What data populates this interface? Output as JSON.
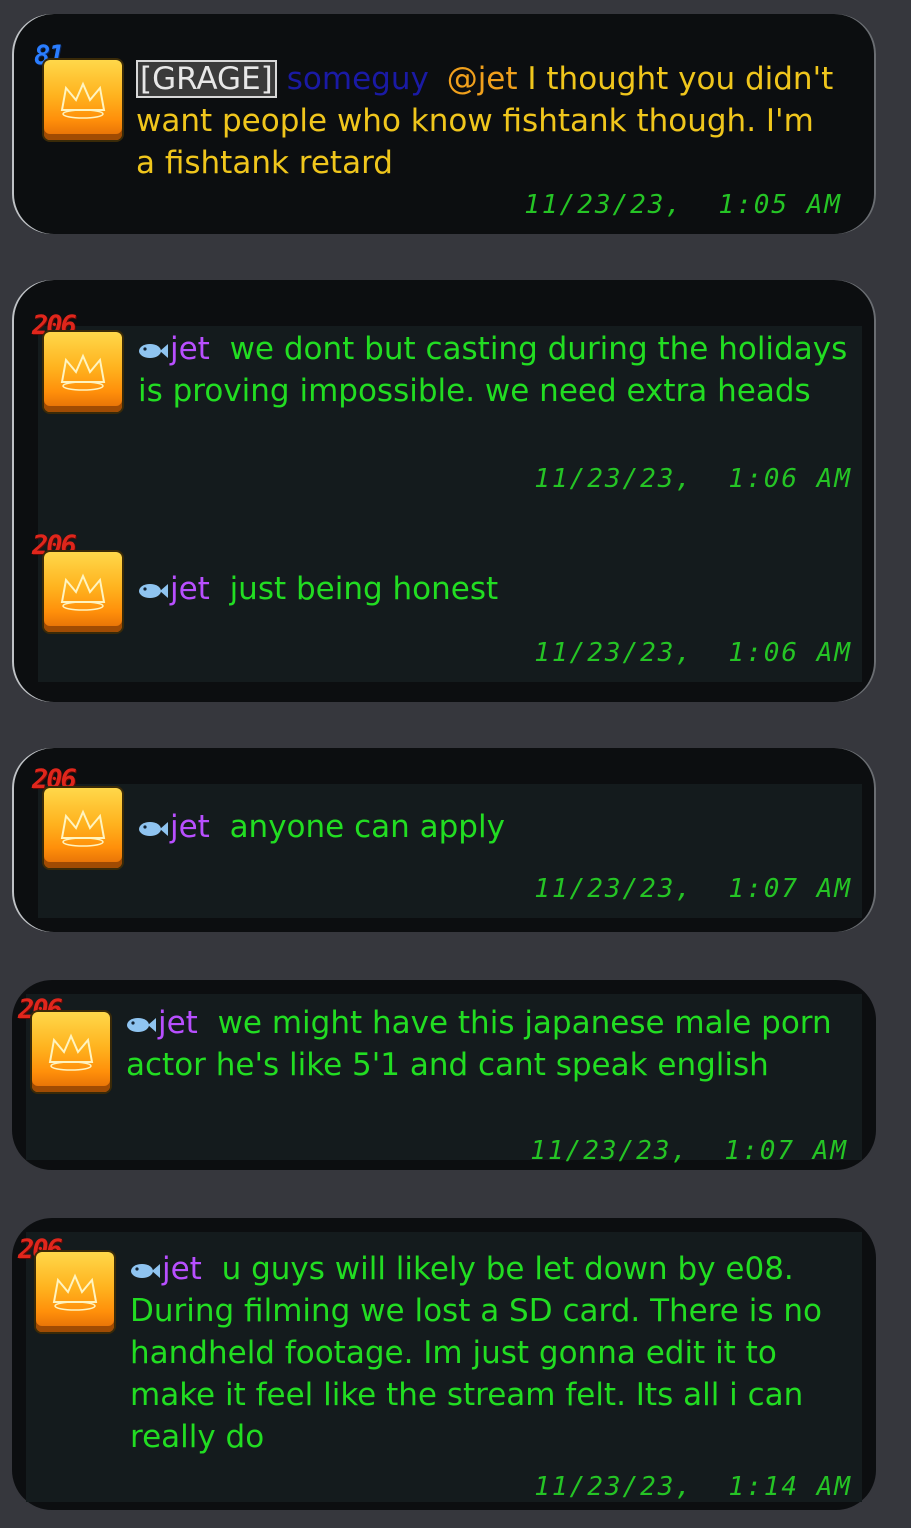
{
  "colors": {
    "background": "#36373d",
    "card": "#0c0e10",
    "message_green": "#22dd22",
    "message_yellow": "#f0c61c",
    "username_purple": "#b84fff",
    "badge_red": "#e0261c",
    "badge_blue": "#2a7dff"
  },
  "messages": [
    {
      "badge": "81",
      "tag": "[GRAGE]",
      "author": "someguy",
      "mention": "@jet",
      "text_line1": "I thought you",
      "text_rest": "didn't want people who know fishtank though. I'm a fishtank retard",
      "timestamp": "11/23/23,  1:05 AM",
      "avatar_icon": "crown-avatar-icon"
    },
    {
      "badge": "206",
      "author": "jet",
      "text": "we dont but casting during the holidays is proving impossible. we need extra heads",
      "timestamp": "11/23/23,  1:06 AM",
      "avatar_icon": "crown-avatar-icon"
    },
    {
      "badge": "206",
      "author": "jet",
      "text": "just being honest",
      "timestamp": "11/23/23,  1:06 AM",
      "avatar_icon": "crown-avatar-icon"
    },
    {
      "badge": "206",
      "author": "jet",
      "text": "anyone can apply",
      "timestamp": "11/23/23,  1:07 AM",
      "avatar_icon": "crown-avatar-icon"
    },
    {
      "badge": "206",
      "author": "jet",
      "text": "we might have this japanese male porn actor he's like 5'1 and cant speak english",
      "timestamp": "11/23/23,  1:07 AM",
      "avatar_icon": "crown-avatar-icon"
    },
    {
      "badge": "206",
      "author": "jet",
      "text": "u guys will likely be let down by e08. During filming we lost a SD card. There is no handheld footage. Im just gonna edit it to make it feel like the stream felt. Its all i can really do",
      "timestamp": "11/23/23,  1:14 AM",
      "avatar_icon": "crown-avatar-icon"
    }
  ]
}
